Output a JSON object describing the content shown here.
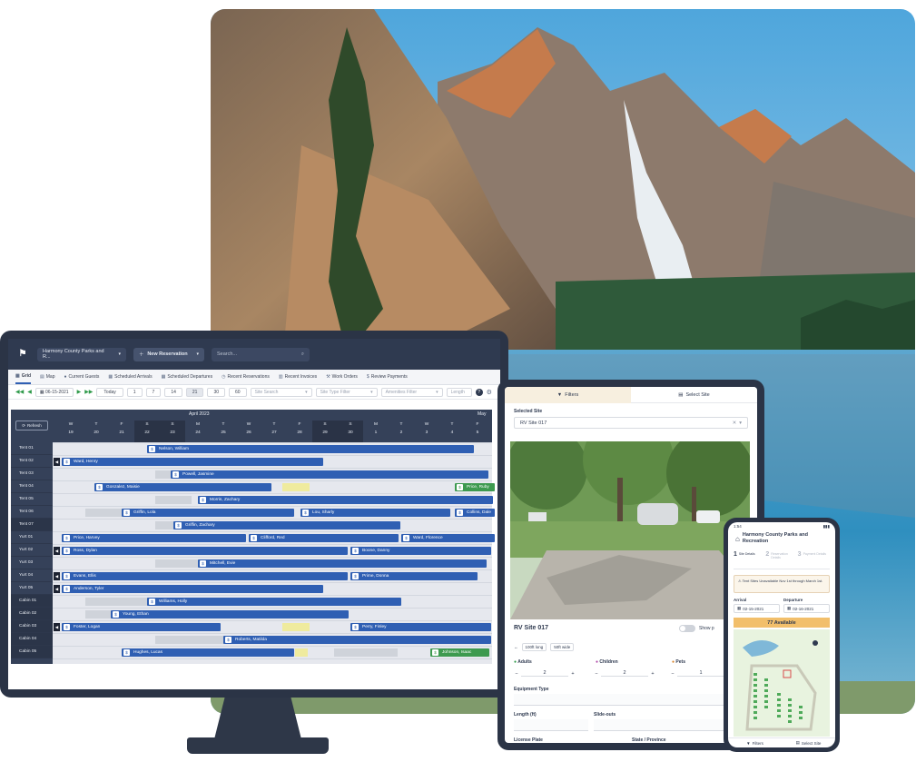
{
  "colors": {
    "accent": "#2f5fb3",
    "header": "#2f3a50",
    "green": "#3d9a4f",
    "available": "#f2bf6b"
  },
  "desktop": {
    "org_select": "Harmony County Parks and R...",
    "new_reservation": "New Reservation",
    "search_placeholder": "Search...",
    "tabs": [
      "Grid",
      "Map",
      "Current Guests",
      "Scheduled Arrivals",
      "Scheduled Departures",
      "Recent Reservations",
      "Recent Invoices",
      "Work Orders",
      "Review Payments"
    ],
    "toolbar": {
      "date": "06-15-2021",
      "today": "Today",
      "ranges": [
        "1",
        "7",
        "14",
        "21",
        "30",
        "60"
      ],
      "site_search": "Site Search",
      "site_type_filter": "Site Type Filter",
      "amenities_filter": "Amenities Filter",
      "length": "Length"
    },
    "refresh": "Refresh",
    "months": [
      "April 2023",
      "May"
    ],
    "days": [
      {
        "w": "W",
        "d": "19"
      },
      {
        "w": "T",
        "d": "20"
      },
      {
        "w": "F",
        "d": "21"
      },
      {
        "w": "S",
        "d": "22"
      },
      {
        "w": "S",
        "d": "23"
      },
      {
        "w": "M",
        "d": "24"
      },
      {
        "w": "T",
        "d": "25"
      },
      {
        "w": "W",
        "d": "26"
      },
      {
        "w": "T",
        "d": "27"
      },
      {
        "w": "F",
        "d": "28"
      },
      {
        "w": "S",
        "d": "29"
      },
      {
        "w": "S",
        "d": "30"
      },
      {
        "w": "M",
        "d": "1"
      },
      {
        "w": "T",
        "d": "2"
      },
      {
        "w": "W",
        "d": "3"
      },
      {
        "w": "T",
        "d": "4"
      },
      {
        "w": "F",
        "d": "5"
      }
    ],
    "sites": [
      "Tent 01",
      "Tent 02",
      "Tent 03",
      "Tent 04",
      "Tent 05",
      "Tent 06",
      "Tent 07",
      "Yurt 01",
      "Yurt 02",
      "Yurt 03",
      "Yurt 04",
      "Yurt 05",
      "Cabin 01",
      "Cabin 02",
      "Cabin 03",
      "Cabin 04",
      "Cabin 05"
    ],
    "reservations": [
      {
        "name": "Nelson, William"
      },
      {
        "name": "Ward, Henry"
      },
      {
        "name": "Powell, Jasmine"
      },
      {
        "name": "Gonzalez, Maisie"
      },
      {
        "name": "Price, Ruby"
      },
      {
        "name": "Morris, Zachary"
      },
      {
        "name": "Griffin, Lola"
      },
      {
        "name": "Lou, Sharly"
      },
      {
        "name": "Collins, Dale"
      },
      {
        "name": "Griffin, Zachary"
      },
      {
        "name": "Price, Harvey"
      },
      {
        "name": "Clifford, Red"
      },
      {
        "name": "Ward, Florence"
      },
      {
        "name": "Ross, Dylan"
      },
      {
        "name": "Boone, Danny"
      },
      {
        "name": "Mitchell, Evie"
      },
      {
        "name": "Evans, Ellis"
      },
      {
        "name": "Prime, Donna"
      },
      {
        "name": "Anderson, Tyler"
      },
      {
        "name": "Williams, Holly"
      },
      {
        "name": "Young, Ethan"
      },
      {
        "name": "Foster, Logan"
      },
      {
        "name": "Perry, Finley"
      },
      {
        "name": "Roberts, Matilda"
      },
      {
        "name": "Hughes, Lucas"
      },
      {
        "name": "Johnson, Isaac"
      }
    ]
  },
  "tablet": {
    "tab_filters": "Filters",
    "tab_select_site": "Select Site",
    "selected_site_label": "Selected Site",
    "selected_site_value": "RV Site 017",
    "site_title": "RV Site 017",
    "show_label": "Show p",
    "chips": [
      "100ft long",
      "50ft wide"
    ],
    "adults_label": "Adults",
    "children_label": "Children",
    "pets_label": "Pets",
    "adults": "2",
    "children": "2",
    "pets": "1",
    "equipment_type": "Equipment Type",
    "length_ft": "Length (ft)",
    "slide_outs": "Slide-outs",
    "license_plate": "License Plate",
    "state_province": "State / Province"
  },
  "phone": {
    "time": "1:54",
    "title": "Harmony County Parks and Recreation",
    "steps": [
      {
        "n": "1",
        "l": "Site Details"
      },
      {
        "n": "2",
        "l": "Reservation Details"
      },
      {
        "n": "3",
        "l": "Payment Details"
      }
    ],
    "alert": "Tent Sites Unavailable Nov 1st through March 1st.",
    "arrival_label": "Arrival",
    "departure_label": "Departure",
    "arrival": "02-15-2021",
    "departure": "02-16-2021",
    "available": "77 Available",
    "filters": "Filters",
    "select_site": "Select Site"
  }
}
